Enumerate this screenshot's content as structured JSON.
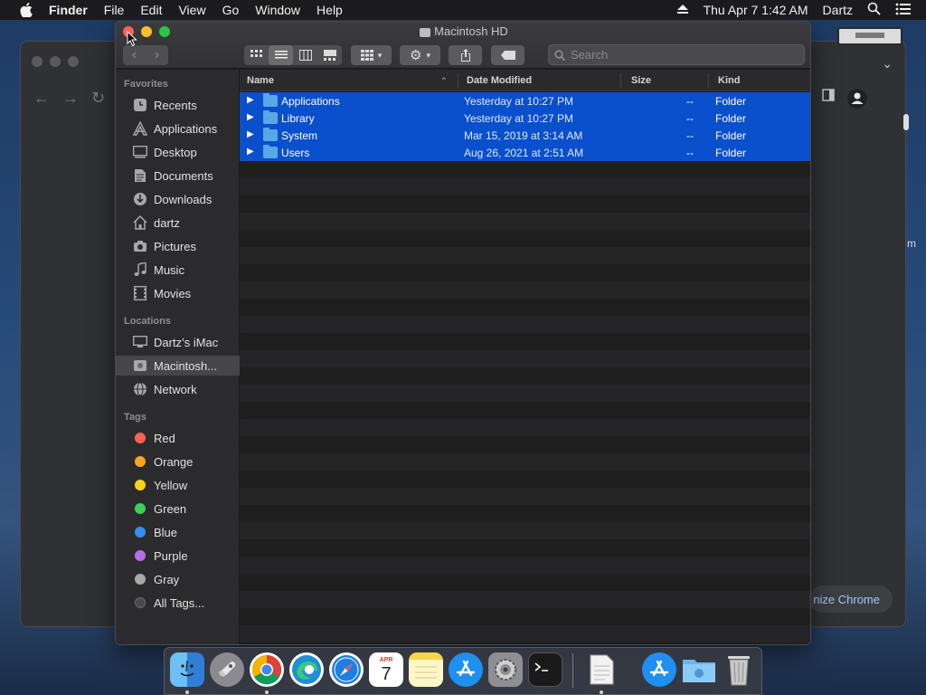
{
  "menubar": {
    "items": [
      "Finder",
      "File",
      "Edit",
      "View",
      "Go",
      "Window",
      "Help"
    ],
    "datetime": "Thu Apr 7  1:42 AM",
    "user": "Dartz"
  },
  "chrome": {
    "customize_partial": "nize Chrome",
    "edge_char": "m"
  },
  "finder": {
    "title": "Macintosh HD",
    "search_placeholder": "Search",
    "sidebar": {
      "favorites_label": "Favorites",
      "favorites": [
        {
          "label": "Recents",
          "icon": "clock-icon"
        },
        {
          "label": "Applications",
          "icon": "applications-icon"
        },
        {
          "label": "Desktop",
          "icon": "desktop-icon"
        },
        {
          "label": "Documents",
          "icon": "document-icon"
        },
        {
          "label": "Downloads",
          "icon": "download-icon"
        },
        {
          "label": "dartz",
          "icon": "home-icon"
        },
        {
          "label": "Pictures",
          "icon": "camera-icon"
        },
        {
          "label": "Music",
          "icon": "music-icon"
        },
        {
          "label": "Movies",
          "icon": "film-icon"
        }
      ],
      "locations_label": "Locations",
      "locations": [
        {
          "label": "Dartz’s iMac",
          "icon": "computer-icon"
        },
        {
          "label": "Macintosh...",
          "icon": "disk-icon"
        },
        {
          "label": "Network",
          "icon": "network-icon"
        }
      ],
      "tags_label": "Tags",
      "tags": [
        {
          "label": "Red",
          "color": "#ff5f57"
        },
        {
          "label": "Orange",
          "color": "#f6a623"
        },
        {
          "label": "Yellow",
          "color": "#f7d21c"
        },
        {
          "label": "Green",
          "color": "#3dd052"
        },
        {
          "label": "Blue",
          "color": "#3b8cf0"
        },
        {
          "label": "Purple",
          "color": "#b86ee8"
        },
        {
          "label": "Gray",
          "color": "#a8a8a8"
        },
        {
          "label": "All Tags...",
          "color": "#4a4a4c"
        }
      ]
    },
    "columns": {
      "name": "Name",
      "date": "Date Modified",
      "size": "Size",
      "kind": "Kind"
    },
    "rows": [
      {
        "name": "Applications",
        "date": "Yesterday at 10:27 PM",
        "size": "--",
        "kind": "Folder"
      },
      {
        "name": "Library",
        "date": "Yesterday at 10:27 PM",
        "size": "--",
        "kind": "Folder"
      },
      {
        "name": "System",
        "date": "Mar 15, 2019 at 3:14 AM",
        "size": "--",
        "kind": "Folder"
      },
      {
        "name": "Users",
        "date": "Aug 26, 2021 at 2:51 AM",
        "size": "--",
        "kind": "Folder"
      }
    ]
  },
  "dock": {
    "apps": [
      {
        "name": "Finder",
        "icon": "finder-icon",
        "color": "#3a8ee6",
        "running": true
      },
      {
        "name": "Launchpad",
        "icon": "rocket-icon",
        "color": "#8a8a90",
        "running": false
      },
      {
        "name": "Chrome",
        "icon": "chrome-icon",
        "color": "#ffffff",
        "running": true
      },
      {
        "name": "Edge",
        "icon": "edge-icon",
        "color": "#1c8fd8",
        "running": false
      },
      {
        "name": "Safari",
        "icon": "compass-icon",
        "color": "#1e7fe0",
        "running": false
      },
      {
        "name": "Calendar",
        "icon": "calendar-icon",
        "color": "#ffffff",
        "running": false,
        "label": "7",
        "sublabel": "APR"
      },
      {
        "name": "Notes",
        "icon": "notes-icon",
        "color": "#f7e27a",
        "running": false
      },
      {
        "name": "App Store",
        "icon": "appstore-icon",
        "color": "#1f8ff0",
        "running": false
      },
      {
        "name": "System Preferences",
        "icon": "gear-icon",
        "color": "#8e8e93",
        "running": false
      },
      {
        "name": "Terminal",
        "icon": "terminal-icon",
        "color": "#1a1a1a",
        "running": false
      }
    ],
    "right": [
      {
        "name": "TextEdit",
        "icon": "document-icon",
        "color": "#e8e8e8",
        "running": true
      },
      {
        "name": "App Store Downloads",
        "icon": "appstore-icon",
        "color": "#1f8ff0",
        "running": false
      },
      {
        "name": "Downloads folder",
        "icon": "folder-icon",
        "color": "#6cb4ec",
        "running": false
      },
      {
        "name": "Trash",
        "icon": "trash-icon",
        "color": "#c9c9c9",
        "running": false
      }
    ]
  }
}
